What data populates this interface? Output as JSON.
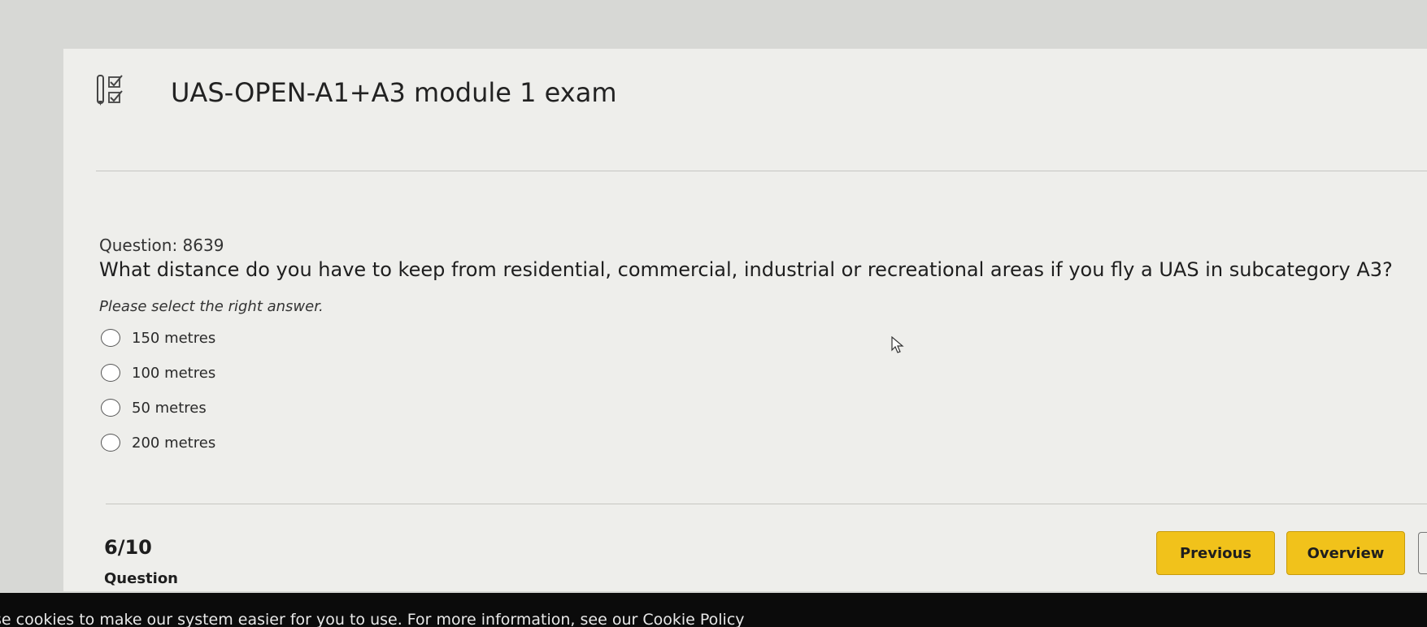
{
  "header": {
    "icon": "exam-checklist-icon",
    "title": "UAS-OPEN-A1+A3 module 1 exam"
  },
  "question": {
    "number": "Question: 8639",
    "text": "What distance do you have to keep from residential, commercial, industrial or recreational areas if you fly a UAS in subcategory A3?",
    "instruction": "Please select the right answer.",
    "options": [
      {
        "label": "150 metres",
        "selected": false
      },
      {
        "label": "100 metres",
        "selected": false
      },
      {
        "label": "50 metres",
        "selected": false
      },
      {
        "label": "200 metres",
        "selected": false
      }
    ]
  },
  "footer": {
    "progress": "6/10",
    "progress_label": "Question",
    "previous_label": "Previous",
    "overview_label": "Overview"
  },
  "cookie_banner": {
    "text": "se cookies to make our system easier for you to use. For more information, see our Cookie Policy"
  },
  "colors": {
    "accent": "#f1c21b",
    "background": "#eeeeeb",
    "banner": "#0b0b0b"
  }
}
